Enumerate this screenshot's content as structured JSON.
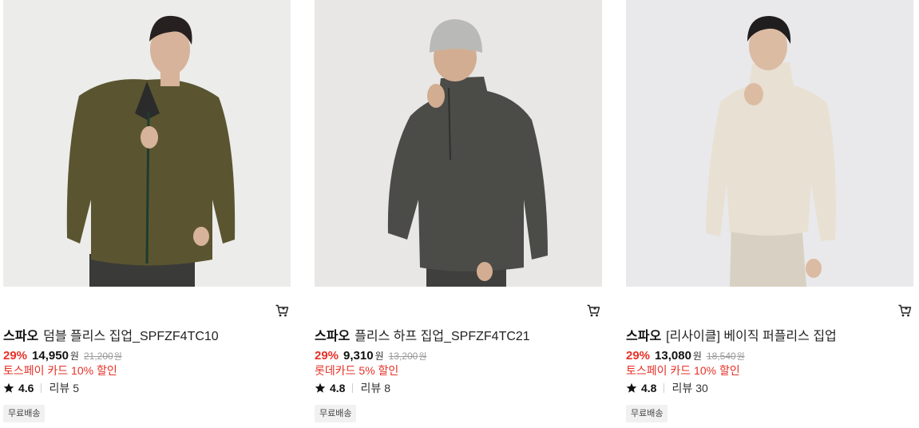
{
  "products": [
    {
      "brand": "스파오",
      "name": "덤블 플리스 집업_SPFZF4TC10",
      "discount": "29%",
      "price": "14,950",
      "currency": "원",
      "original_price": "21,200",
      "promo": "토스페이 카드 10% 할인",
      "rating": "4.6",
      "review_label": "리뷰",
      "review_count": "5",
      "badge": "무료배송",
      "colors": {
        "bg": "#ececea",
        "jacket": "#5a5530",
        "skin": "#d6b39a",
        "hair": "#262020",
        "pants": "#3a3a38"
      }
    },
    {
      "brand": "스파오",
      "name": "플리스 하프 집업_SPFZF4TC21",
      "discount": "29%",
      "price": "9,310",
      "currency": "원",
      "original_price": "13,200",
      "promo": "롯데카드 5% 할인",
      "rating": "4.8",
      "review_label": "리뷰",
      "review_count": "8",
      "badge": "무료배송",
      "colors": {
        "bg": "#e8e7e5",
        "jacket": "#4b4b48",
        "skin": "#d2ad92",
        "hair": "#b9b9b7",
        "pants": "#3f3f3d"
      }
    },
    {
      "brand": "스파오",
      "name": "[리사이클] 베이직 퍼플리스 집업",
      "discount": "29%",
      "price": "13,080",
      "currency": "원",
      "original_price": "18,540",
      "promo": "토스페이 카드 10% 할인",
      "rating": "4.8",
      "review_label": "리뷰",
      "review_count": "30",
      "badge": "무료배송",
      "colors": {
        "bg": "#e9e9eb",
        "jacket": "#e8e0d2",
        "skin": "#dcbba3",
        "hair": "#1f1d1d",
        "pants": "#d8d0c2"
      }
    }
  ]
}
